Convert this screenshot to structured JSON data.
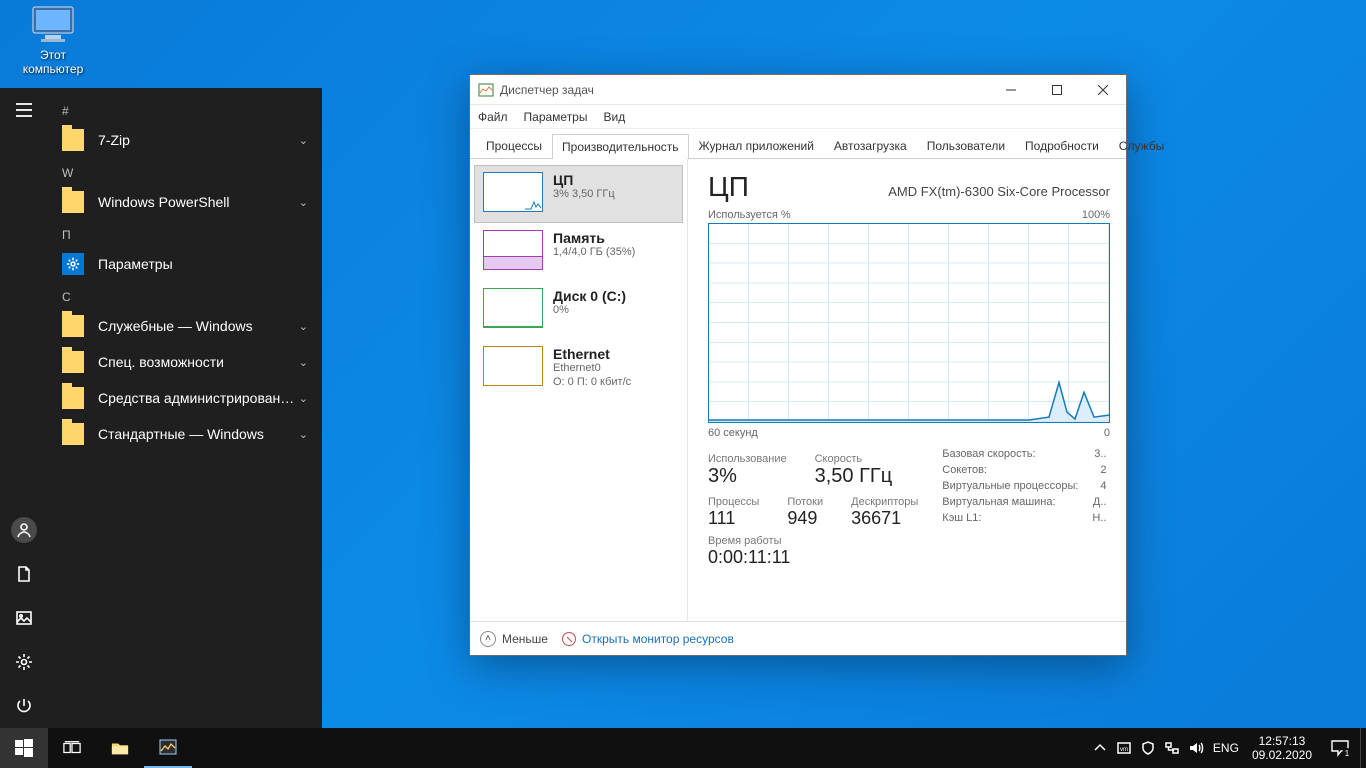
{
  "desktop": {
    "this_pc_label": "Этот\nкомпьютер"
  },
  "start": {
    "groups": [
      {
        "header": "#",
        "items": [
          {
            "label": "7-Zip",
            "icon": "folder",
            "expandable": true
          }
        ]
      },
      {
        "header": "W",
        "items": [
          {
            "label": "Windows PowerShell",
            "icon": "folder",
            "expandable": true
          }
        ]
      },
      {
        "header": "П",
        "items": [
          {
            "label": "Параметры",
            "icon": "gear",
            "expandable": false
          }
        ]
      },
      {
        "header": "С",
        "items": [
          {
            "label": "Служебные — Windows",
            "icon": "folder",
            "expandable": true
          },
          {
            "label": "Спец. возможности",
            "icon": "folder",
            "expandable": true
          },
          {
            "label": "Средства администрирования...",
            "icon": "folder",
            "expandable": true
          },
          {
            "label": "Стандартные — Windows",
            "icon": "folder",
            "expandable": true
          }
        ]
      }
    ]
  },
  "tm": {
    "title": "Диспетчер задач",
    "menu": {
      "file": "Файл",
      "options": "Параметры",
      "view": "Вид"
    },
    "tabs": [
      "Процессы",
      "Производительность",
      "Журнал приложений",
      "Автозагрузка",
      "Пользователи",
      "Подробности",
      "Службы"
    ],
    "active_tab": 1,
    "side": [
      {
        "key": "cpu",
        "title": "ЦП",
        "sub": "3%  3,50 ГГц"
      },
      {
        "key": "mem",
        "title": "Память",
        "sub": "1,4/4,0 ГБ (35%)"
      },
      {
        "key": "disk",
        "title": "Диск 0 (C:)",
        "sub": "0%"
      },
      {
        "key": "net",
        "title": "Ethernet",
        "sub": "Ethernet0",
        "sub2": "О: 0  П: 0 кбит/с"
      }
    ],
    "main": {
      "heading": "ЦП",
      "proc": "AMD FX(tm)-6300 Six-Core Processor",
      "y_label": "Используется %",
      "y_max": "100%",
      "x_left": "60 секунд",
      "x_right": "0",
      "usage_label": "Использование",
      "usage_val": "3%",
      "speed_label": "Скорость",
      "speed_val": "3,50 ГГц",
      "procs_label": "Процессы",
      "procs_val": "111",
      "threads_label": "Потоки",
      "threads_val": "949",
      "handles_label": "Дескрипторы",
      "handles_val": "36671",
      "uptime_label": "Время работы",
      "uptime_val": "0:00:11:11",
      "right": [
        [
          "Базовая скорость:",
          "3.."
        ],
        [
          "Сокетов:",
          "2"
        ],
        [
          "Виртуальные процессоры:",
          "4"
        ],
        [
          "Виртуальная машина:",
          "Д.."
        ],
        [
          "Кэш L1:",
          "Н.."
        ]
      ]
    },
    "footer": {
      "less": "Меньше",
      "monitor": "Открыть монитор ресурсов"
    }
  },
  "taskbar": {
    "lang": "ENG",
    "time": "12:57:13",
    "date": "09.02.2020",
    "notif_count": "1"
  }
}
